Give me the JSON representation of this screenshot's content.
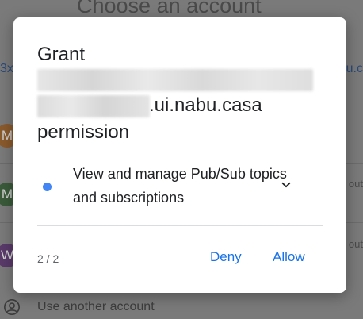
{
  "background": {
    "title": "Choose an account",
    "left_link_fragment": "3x",
    "right_link_fragment": "u.c",
    "accounts": [
      {
        "initial": "M",
        "color": "#8a5a2c",
        "right_text": ""
      },
      {
        "initial": "M",
        "color": "#3a5a3a",
        "right_text": "out"
      },
      {
        "initial": "W",
        "color": "#5a3a6a",
        "right_text": "out"
      }
    ],
    "use_another_account": "Use another account"
  },
  "dialog": {
    "grant_label": "Grant",
    "domain_suffix": ".ui.nabu.casa",
    "permission_label": "permission",
    "scope": {
      "text": "View and manage Pub/Sub topics and subscriptions",
      "dot_color": "#4285f4"
    },
    "page_indicator": "2 / 2",
    "deny_label": "Deny",
    "allow_label": "Allow",
    "accent_color": "#1a73e8"
  }
}
